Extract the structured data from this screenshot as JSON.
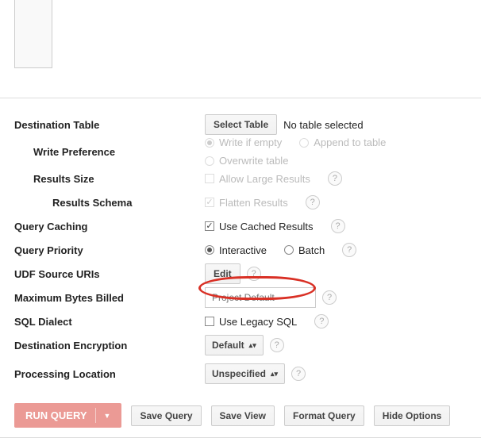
{
  "destTable": {
    "label": "Destination Table",
    "selectBtn": "Select Table",
    "status": "No table selected"
  },
  "writePref": {
    "label": "Write Preference",
    "options": {
      "empty": "Write if empty",
      "append": "Append to table",
      "overwrite": "Overwrite table"
    }
  },
  "resultsSize": {
    "label": "Results Size",
    "allowLarge": "Allow Large Results"
  },
  "resultsSchema": {
    "label": "Results Schema",
    "flatten": "Flatten Results"
  },
  "caching": {
    "label": "Query Caching",
    "useCached": "Use Cached Results"
  },
  "priority": {
    "label": "Query Priority",
    "interactive": "Interactive",
    "batch": "Batch"
  },
  "udf": {
    "label": "UDF Source URIs",
    "editBtn": "Edit"
  },
  "maxBytes": {
    "label": "Maximum Bytes Billed",
    "placeholder": "Project Default"
  },
  "sqlDialect": {
    "label": "SQL Dialect",
    "useLegacy": "Use Legacy SQL"
  },
  "encryption": {
    "label": "Destination Encryption",
    "value": "Default"
  },
  "location": {
    "label": "Processing Location",
    "value": "Unspecified"
  },
  "buttons": {
    "run": "RUN QUERY",
    "save": "Save Query",
    "saveView": "Save View",
    "format": "Format Query",
    "hide": "Hide Options"
  },
  "help": "?"
}
